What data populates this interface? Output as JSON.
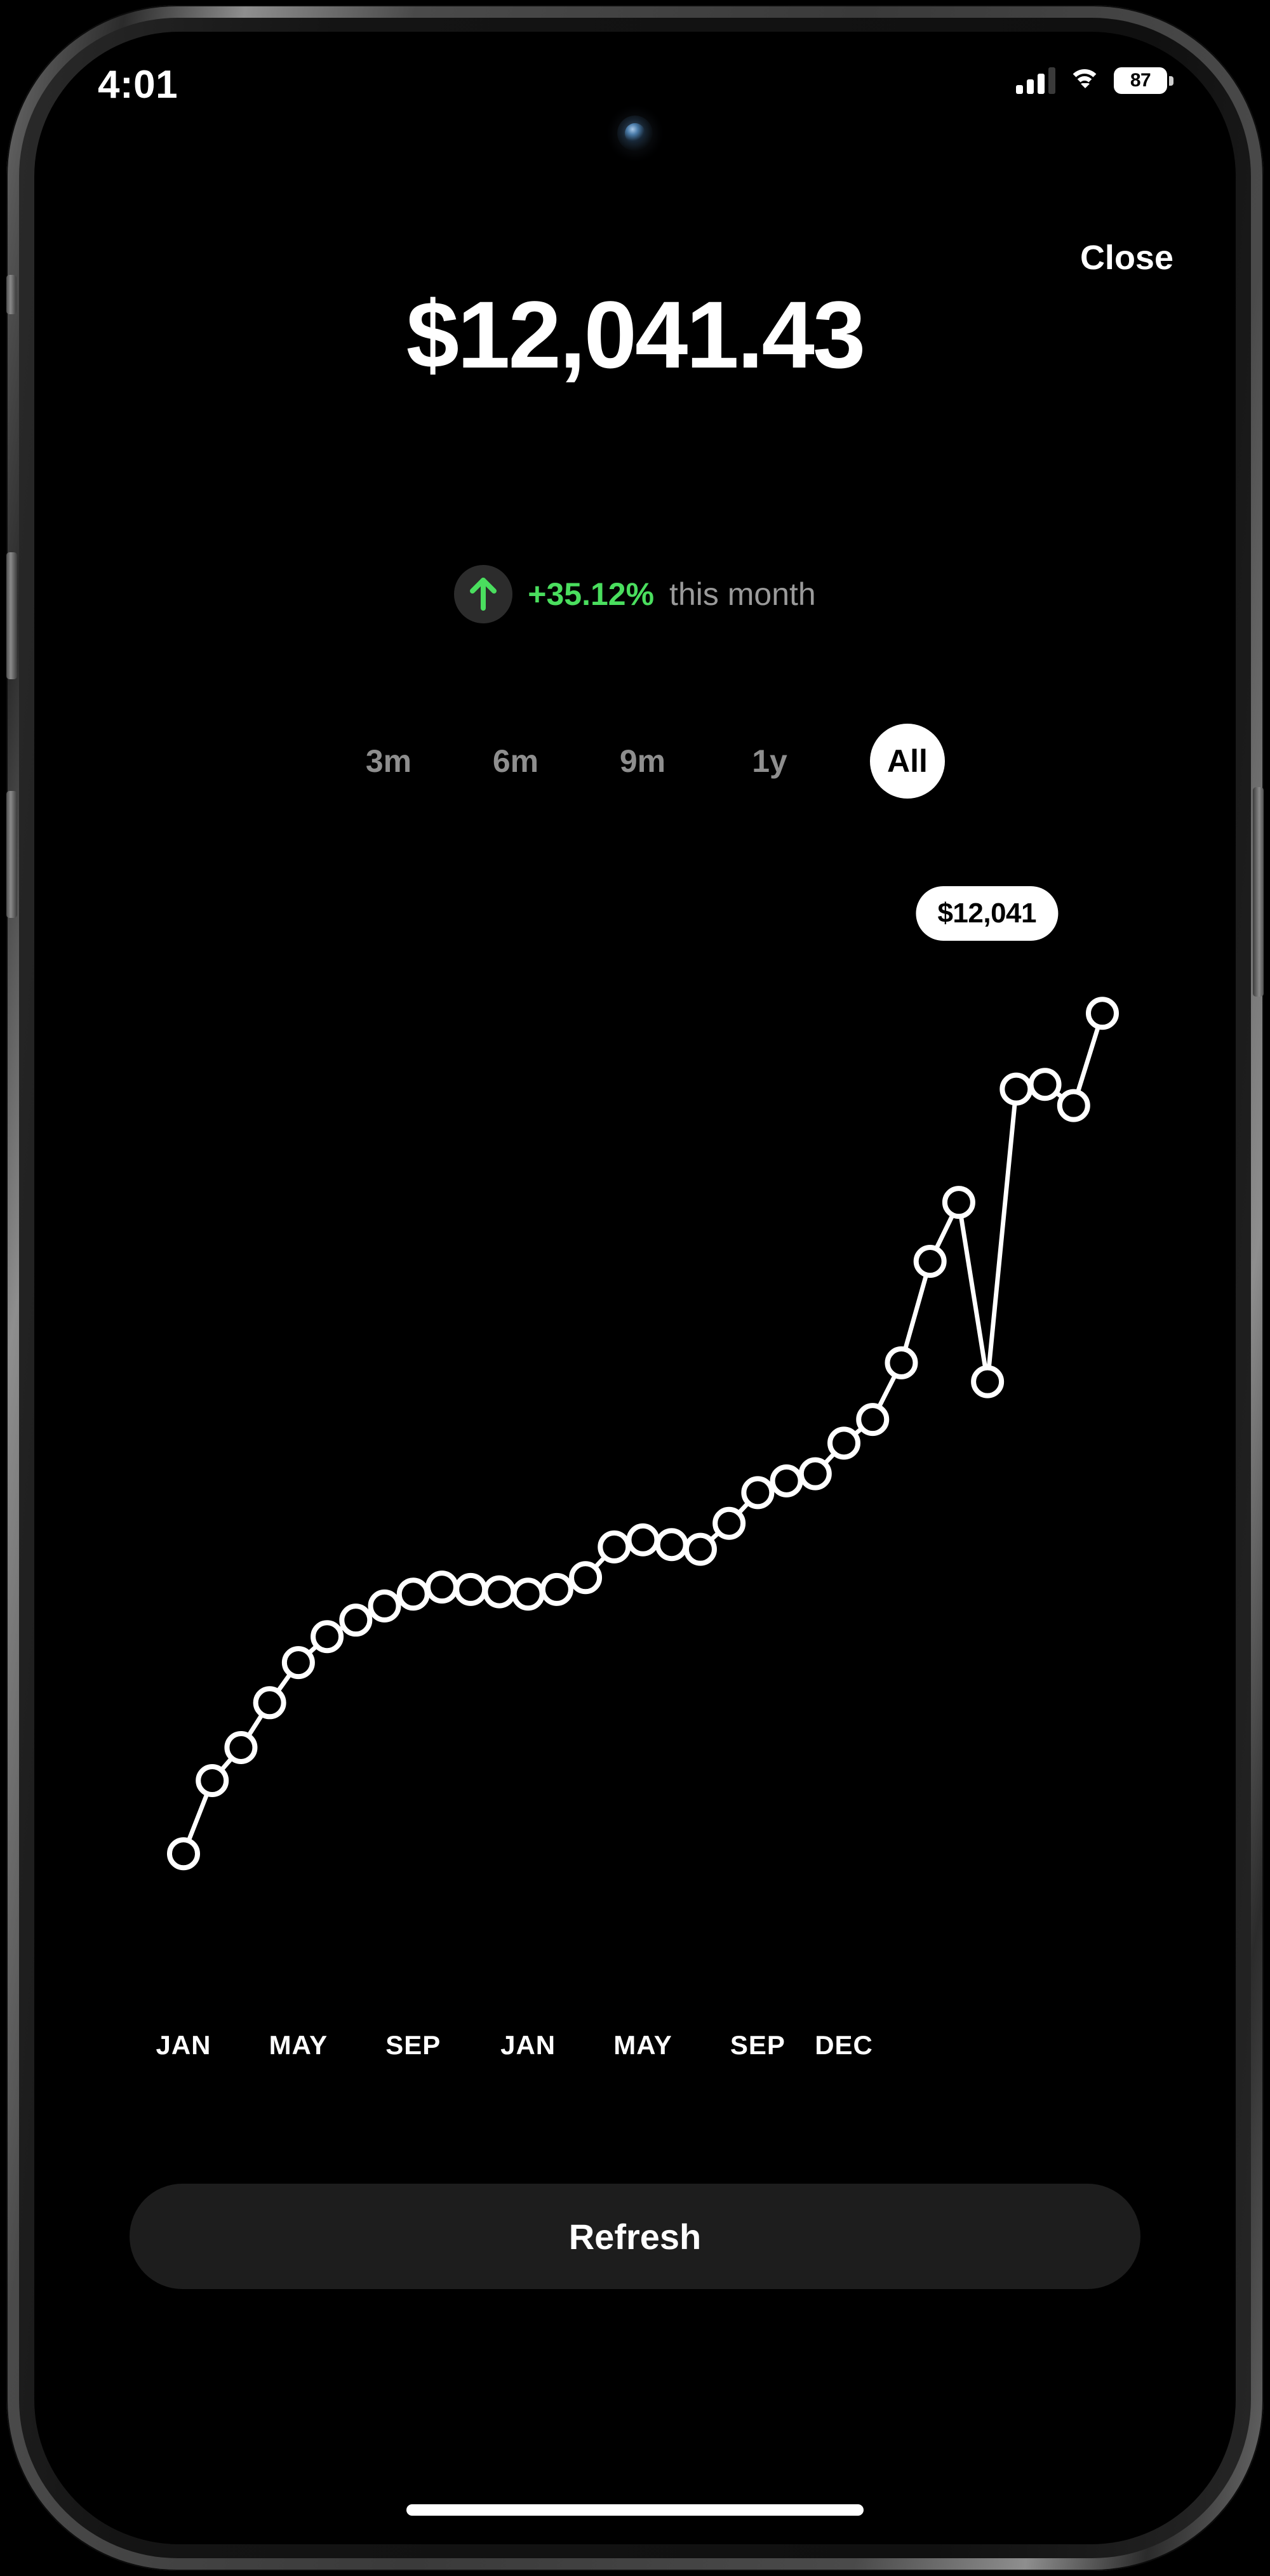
{
  "status_bar": {
    "time": "4:01",
    "cellular_icon": "cellular-bars-icon",
    "cellular_bars_filled": 3,
    "cellular_bars_total": 4,
    "wifi_icon": "wifi-icon",
    "battery_icon": "battery-icon",
    "battery_level": "87"
  },
  "header": {
    "close_label": "Close",
    "balance": "$12,041.43"
  },
  "change": {
    "arrow_icon": "arrow-up-icon",
    "percent": "+35.12%",
    "period_label": "this month",
    "positive_color": "#4ade5e",
    "label_color": "#9a9a9a"
  },
  "ranges": {
    "options": [
      "3m",
      "6m",
      "9m",
      "1y",
      "All"
    ],
    "selected": "All"
  },
  "tooltip": {
    "value": "$12,041"
  },
  "actions": {
    "refresh_label": "Refresh"
  },
  "chart_data": {
    "type": "line",
    "title": "",
    "xlabel": "",
    "ylabel": "",
    "legend": [],
    "grid": false,
    "marker": "open-circle",
    "line_color": "#ffffff",
    "marker_fill": "#000000",
    "xlim": [
      0,
      35
    ],
    "ylim": [
      8400,
      12300
    ],
    "tick_labels": [
      "JAN",
      "MAY",
      "SEP",
      "JAN",
      "MAY",
      "SEP",
      "DEC"
    ],
    "tick_x": [
      0,
      4,
      8,
      12,
      16,
      20,
      23
    ],
    "x": [
      0,
      1,
      2,
      3,
      4,
      5,
      6,
      7,
      8,
      9,
      10,
      11,
      12,
      13,
      14,
      15,
      16,
      17,
      18,
      19,
      20,
      21,
      22,
      23,
      24,
      25,
      26,
      27,
      28,
      29,
      30,
      31,
      32,
      33,
      34
    ],
    "values": [
      8480,
      8790,
      8930,
      9120,
      9290,
      9400,
      9470,
      9530,
      9580,
      9610,
      9600,
      9590,
      9580,
      9600,
      9650,
      9780,
      9810,
      9790,
      9770,
      9880,
      10010,
      10060,
      10090,
      10220,
      10320,
      10560,
      10990,
      11240,
      10480,
      11720,
      11740,
      11650,
      12041
    ],
    "annotation": {
      "label": "$12,041",
      "at_index": 32
    }
  }
}
